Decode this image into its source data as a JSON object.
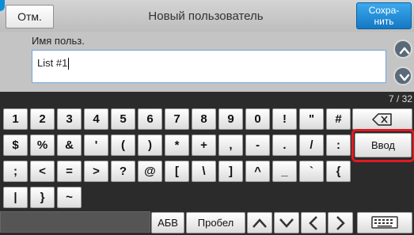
{
  "header": {
    "cancel_label": "Отм.",
    "title": "Новый пользователь",
    "save_label_line1": "Сохра-",
    "save_label_line2": "нить",
    "accent_color": "#1478c4"
  },
  "form": {
    "field_label": "Имя польз.",
    "field_value": "List #1"
  },
  "keyboard": {
    "page_counter": "7 / 32",
    "row1": [
      "1",
      "2",
      "3",
      "4",
      "5",
      "6",
      "7",
      "8",
      "9",
      "0",
      "!",
      "\"",
      "#"
    ],
    "row2": [
      "$",
      "%",
      "&",
      "'",
      "(",
      ")",
      "*",
      "+",
      ",",
      "-",
      ".",
      "/",
      ":"
    ],
    "row3": [
      ";",
      "<",
      "=",
      ">",
      "?",
      "@",
      "[",
      "\\",
      "]",
      "^",
      "_",
      "`",
      "{"
    ],
    "row4": [
      "|",
      "}",
      "~"
    ],
    "backspace_icon": "backspace-icon",
    "enter_label": "Ввод",
    "alphabet_label": "АБВ",
    "space_label": "Пробел",
    "highlight_color": "#e01a22"
  }
}
